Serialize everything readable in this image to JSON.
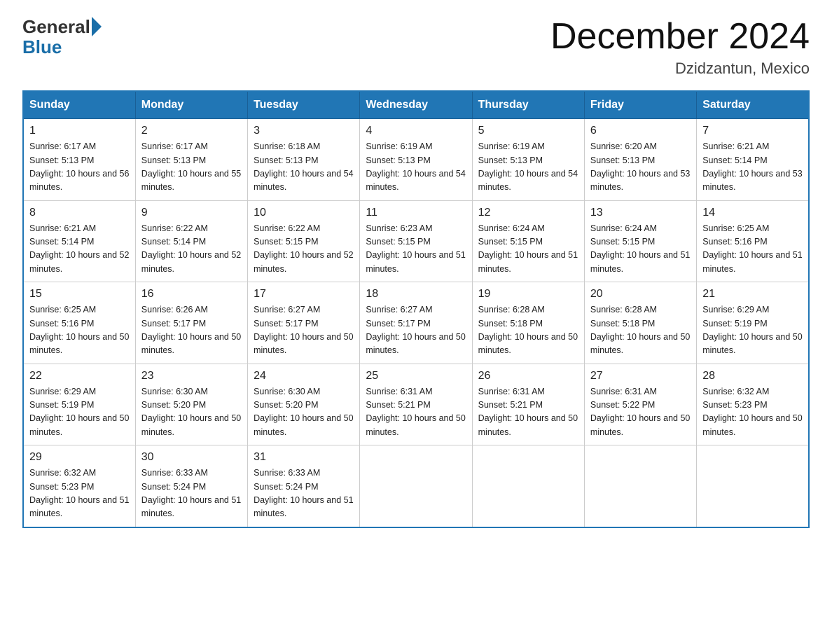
{
  "logo": {
    "general": "General",
    "blue": "Blue"
  },
  "header": {
    "title": "December 2024",
    "location": "Dzidzantun, Mexico"
  },
  "days_of_week": [
    "Sunday",
    "Monday",
    "Tuesday",
    "Wednesday",
    "Thursday",
    "Friday",
    "Saturday"
  ],
  "weeks": [
    [
      {
        "num": "1",
        "sunrise": "6:17 AM",
        "sunset": "5:13 PM",
        "daylight": "10 hours and 56 minutes."
      },
      {
        "num": "2",
        "sunrise": "6:17 AM",
        "sunset": "5:13 PM",
        "daylight": "10 hours and 55 minutes."
      },
      {
        "num": "3",
        "sunrise": "6:18 AM",
        "sunset": "5:13 PM",
        "daylight": "10 hours and 54 minutes."
      },
      {
        "num": "4",
        "sunrise": "6:19 AM",
        "sunset": "5:13 PM",
        "daylight": "10 hours and 54 minutes."
      },
      {
        "num": "5",
        "sunrise": "6:19 AM",
        "sunset": "5:13 PM",
        "daylight": "10 hours and 54 minutes."
      },
      {
        "num": "6",
        "sunrise": "6:20 AM",
        "sunset": "5:13 PM",
        "daylight": "10 hours and 53 minutes."
      },
      {
        "num": "7",
        "sunrise": "6:21 AM",
        "sunset": "5:14 PM",
        "daylight": "10 hours and 53 minutes."
      }
    ],
    [
      {
        "num": "8",
        "sunrise": "6:21 AM",
        "sunset": "5:14 PM",
        "daylight": "10 hours and 52 minutes."
      },
      {
        "num": "9",
        "sunrise": "6:22 AM",
        "sunset": "5:14 PM",
        "daylight": "10 hours and 52 minutes."
      },
      {
        "num": "10",
        "sunrise": "6:22 AM",
        "sunset": "5:15 PM",
        "daylight": "10 hours and 52 minutes."
      },
      {
        "num": "11",
        "sunrise": "6:23 AM",
        "sunset": "5:15 PM",
        "daylight": "10 hours and 51 minutes."
      },
      {
        "num": "12",
        "sunrise": "6:24 AM",
        "sunset": "5:15 PM",
        "daylight": "10 hours and 51 minutes."
      },
      {
        "num": "13",
        "sunrise": "6:24 AM",
        "sunset": "5:15 PM",
        "daylight": "10 hours and 51 minutes."
      },
      {
        "num": "14",
        "sunrise": "6:25 AM",
        "sunset": "5:16 PM",
        "daylight": "10 hours and 51 minutes."
      }
    ],
    [
      {
        "num": "15",
        "sunrise": "6:25 AM",
        "sunset": "5:16 PM",
        "daylight": "10 hours and 50 minutes."
      },
      {
        "num": "16",
        "sunrise": "6:26 AM",
        "sunset": "5:17 PM",
        "daylight": "10 hours and 50 minutes."
      },
      {
        "num": "17",
        "sunrise": "6:27 AM",
        "sunset": "5:17 PM",
        "daylight": "10 hours and 50 minutes."
      },
      {
        "num": "18",
        "sunrise": "6:27 AM",
        "sunset": "5:17 PM",
        "daylight": "10 hours and 50 minutes."
      },
      {
        "num": "19",
        "sunrise": "6:28 AM",
        "sunset": "5:18 PM",
        "daylight": "10 hours and 50 minutes."
      },
      {
        "num": "20",
        "sunrise": "6:28 AM",
        "sunset": "5:18 PM",
        "daylight": "10 hours and 50 minutes."
      },
      {
        "num": "21",
        "sunrise": "6:29 AM",
        "sunset": "5:19 PM",
        "daylight": "10 hours and 50 minutes."
      }
    ],
    [
      {
        "num": "22",
        "sunrise": "6:29 AM",
        "sunset": "5:19 PM",
        "daylight": "10 hours and 50 minutes."
      },
      {
        "num": "23",
        "sunrise": "6:30 AM",
        "sunset": "5:20 PM",
        "daylight": "10 hours and 50 minutes."
      },
      {
        "num": "24",
        "sunrise": "6:30 AM",
        "sunset": "5:20 PM",
        "daylight": "10 hours and 50 minutes."
      },
      {
        "num": "25",
        "sunrise": "6:31 AM",
        "sunset": "5:21 PM",
        "daylight": "10 hours and 50 minutes."
      },
      {
        "num": "26",
        "sunrise": "6:31 AM",
        "sunset": "5:21 PM",
        "daylight": "10 hours and 50 minutes."
      },
      {
        "num": "27",
        "sunrise": "6:31 AM",
        "sunset": "5:22 PM",
        "daylight": "10 hours and 50 minutes."
      },
      {
        "num": "28",
        "sunrise": "6:32 AM",
        "sunset": "5:23 PM",
        "daylight": "10 hours and 50 minutes."
      }
    ],
    [
      {
        "num": "29",
        "sunrise": "6:32 AM",
        "sunset": "5:23 PM",
        "daylight": "10 hours and 51 minutes."
      },
      {
        "num": "30",
        "sunrise": "6:33 AM",
        "sunset": "5:24 PM",
        "daylight": "10 hours and 51 minutes."
      },
      {
        "num": "31",
        "sunrise": "6:33 AM",
        "sunset": "5:24 PM",
        "daylight": "10 hours and 51 minutes."
      },
      null,
      null,
      null,
      null
    ]
  ]
}
